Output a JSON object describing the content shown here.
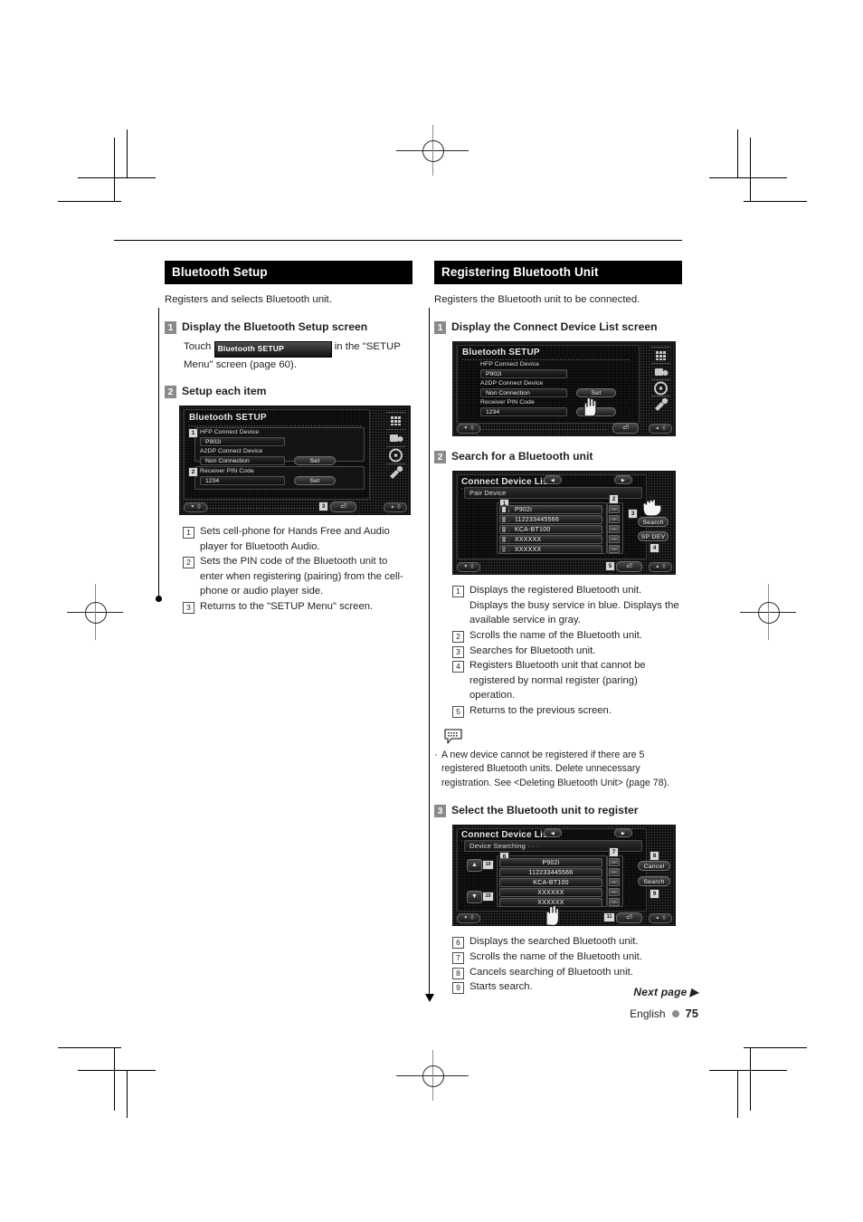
{
  "page": {
    "language": "English",
    "page_number": "75",
    "next_page_label": "Next page",
    "next_page_arrow": "▶"
  },
  "left_column": {
    "banner": "Bluetooth Setup",
    "intro": "Registers and selects Bluetooth unit.",
    "steps": [
      {
        "num": "1",
        "title": "Display the Bluetooth Setup screen",
        "body_before": "Touch",
        "inline_button": "Bluetooth SETUP",
        "body_after": "in the \"SETUP Menu\" screen (page 60)."
      },
      {
        "num": "2",
        "title": "Setup each item"
      }
    ],
    "device_screen": {
      "title": "Bluetooth SETUP",
      "fields": [
        {
          "label": "HFP Connect Device",
          "value": "P902i",
          "button": ""
        },
        {
          "label": "A2DP Connect Device",
          "value": "Non Connection",
          "button": "Set"
        },
        {
          "label": "Receiver PIN Code",
          "value": "1234",
          "button": "Set"
        }
      ],
      "callouts": [
        "1",
        "2",
        "3"
      ]
    },
    "numbered_notes": [
      {
        "num": "1",
        "text": "Sets cell-phone for Hands Free and Audio player for Bluetooth Audio."
      },
      {
        "num": "2",
        "text": "Sets the PIN code of the Bluetooth unit to enter when registering (pairing) from the cell-phone or audio player side."
      },
      {
        "num": "3",
        "text": "Returns to the \"SETUP Menu\" screen."
      }
    ]
  },
  "right_column": {
    "banner": "Registering Bluetooth Unit",
    "intro": "Registers the Bluetooth unit to be connected.",
    "step1": {
      "num": "1",
      "title": "Display the Connect Device List screen",
      "device_screen": {
        "title": "Bluetooth SETUP",
        "fields": [
          {
            "label": "HFP Connect Device",
            "value": "P902i",
            "button": ""
          },
          {
            "label": "A2DP Connect Device",
            "value": "Non Connection",
            "button": "Set"
          },
          {
            "label": "Receiver PIN Code",
            "value": "1234",
            "button": ""
          }
        ]
      }
    },
    "step2": {
      "num": "2",
      "title": "Search for a Bluetooth unit",
      "device_screen": {
        "title": "Connect Device List",
        "subbar": "Pair Device",
        "devices": [
          "P902i",
          "112233445566",
          "KCA-BT100",
          "XXXXXX",
          "XXXXXX"
        ],
        "buttons": [
          "Search",
          "SP DEV"
        ],
        "callouts": [
          "1",
          "2",
          "3",
          "4",
          "5"
        ],
        "prev_arrow": "◀",
        "next_arrow": "▶"
      },
      "numbered_notes": [
        {
          "num": "1",
          "text": "Displays the registered Bluetooth unit. Displays the busy service in blue. Displays the available service in gray."
        },
        {
          "num": "2",
          "text": "Scrolls the name of the Bluetooth unit."
        },
        {
          "num": "3",
          "text": "Searches for Bluetooth unit."
        },
        {
          "num": "4",
          "text": "Registers Bluetooth unit that cannot be registered by normal register (paring) operation."
        },
        {
          "num": "5",
          "text": "Returns to the previous screen."
        }
      ],
      "note": {
        "bullet": "·",
        "text": "A new device cannot be registered if there are 5 registered Bluetooth units. Delete unnecessary registration. See <Deleting Bluetooth Unit> (page 78)."
      }
    },
    "step3": {
      "num": "3",
      "title": "Select the Bluetooth unit to register",
      "device_screen": {
        "title": "Connect Device List",
        "subbar": "Device Searching · · ·",
        "devices": [
          "P902i",
          "112233445566",
          "KCA-BT100",
          "XXXXXX",
          "XXXXXX"
        ],
        "buttons": [
          "Cancel",
          "Search"
        ],
        "callouts": [
          "6",
          "7",
          "8",
          "9",
          "10",
          "11"
        ],
        "up_arrow": "▲",
        "down_arrow": "▼"
      },
      "numbered_notes": [
        {
          "num": "6",
          "text": "Displays the searched Bluetooth unit."
        },
        {
          "num": "7",
          "text": "Scrolls the name of the Bluetooth unit."
        },
        {
          "num": "8",
          "text": "Cancels searching of Bluetooth unit."
        },
        {
          "num": "9",
          "text": "Starts search."
        }
      ]
    }
  }
}
